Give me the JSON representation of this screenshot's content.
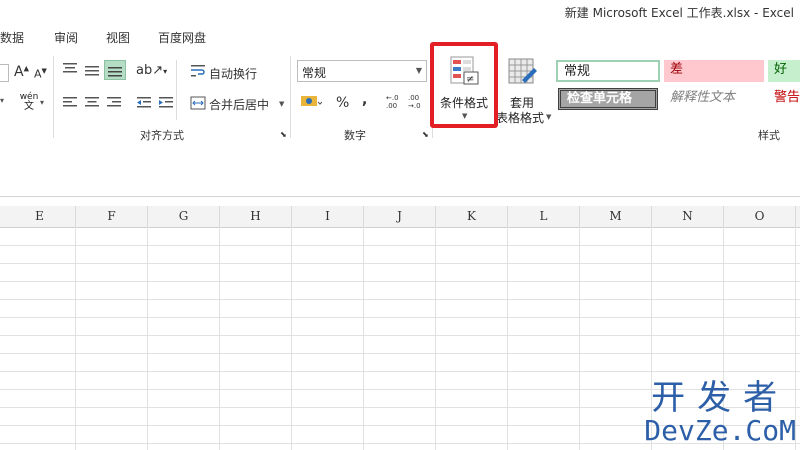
{
  "window": {
    "title": "新建 Microsoft Excel 工作表.xlsx - Excel"
  },
  "tabs": [
    {
      "label": "数据"
    },
    {
      "label": "审阅"
    },
    {
      "label": "视图"
    },
    {
      "label": "百度网盘"
    }
  ],
  "ribbon": {
    "font_group": {
      "increase_font_icon": "A▲",
      "decrease_font_icon": "A▼",
      "phonetic_label": "wén",
      "phonetic_sub": "文"
    },
    "alignment": {
      "wrap_text_label": "自动换行",
      "merge_center_label": "合并后居中",
      "group_label": "对齐方式"
    },
    "number": {
      "format_value": "常规",
      "percent_label": "%",
      "comma_label": ",",
      "inc_decimal_label": "←.0\n.00",
      "dec_decimal_label": ".00\n→.0",
      "group_label": "数字"
    },
    "styles": {
      "conditional_format_label": "条件格式",
      "table_format_line1": "套用",
      "table_format_line2": "表格格式",
      "gallery": [
        {
          "label": "常规"
        },
        {
          "label": "差"
        },
        {
          "label": "好"
        },
        {
          "label": "检查单元格"
        },
        {
          "label": "解释性文本"
        },
        {
          "label": "警告"
        }
      ],
      "group_label": "样式"
    }
  },
  "sheet": {
    "columns": [
      "E",
      "F",
      "G",
      "H",
      "I",
      "J",
      "K",
      "L",
      "M",
      "N",
      "O"
    ]
  },
  "watermark": {
    "line1": "开发者",
    "line2": "DevZe.CoM"
  },
  "colors": {
    "highlight": "#e31e24",
    "good_bg": "#c6efce",
    "bad_bg": "#ffc7ce",
    "bad_text": "#9c0006",
    "warning_text": "#c00000",
    "watermark": "#2d5fa8"
  }
}
